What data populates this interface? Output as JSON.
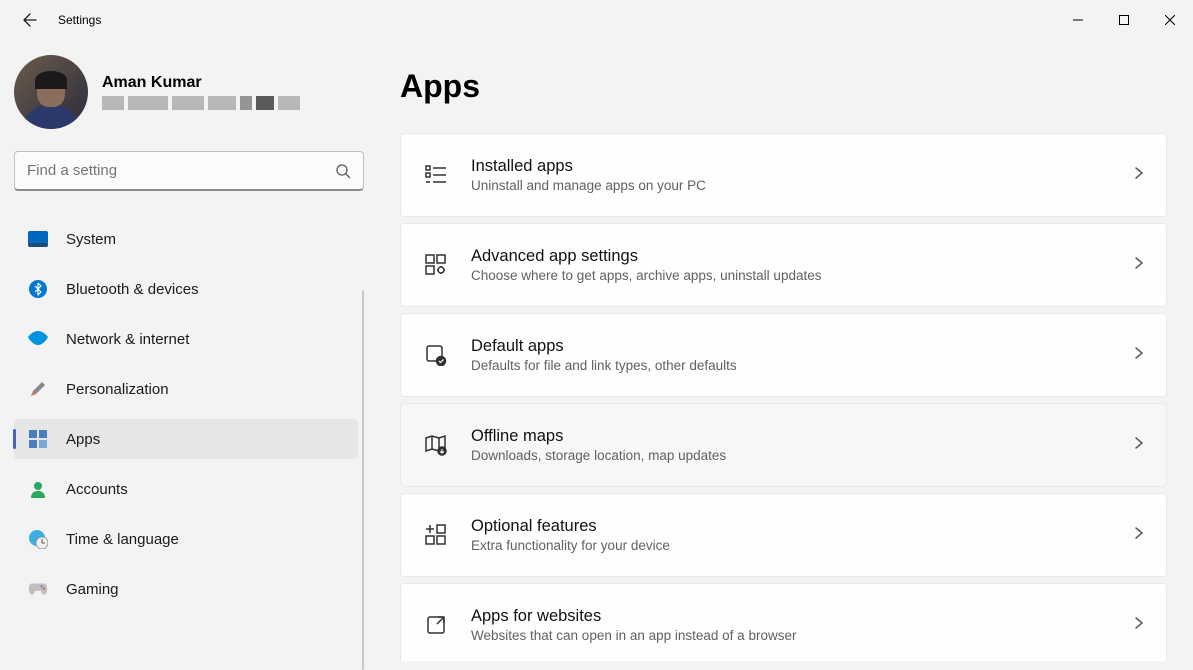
{
  "window": {
    "title": "Settings"
  },
  "profile": {
    "name": "Aman Kumar"
  },
  "search": {
    "placeholder": "Find a setting"
  },
  "sidebar": {
    "items": [
      {
        "label": "System"
      },
      {
        "label": "Bluetooth & devices"
      },
      {
        "label": "Network & internet"
      },
      {
        "label": "Personalization"
      },
      {
        "label": "Apps"
      },
      {
        "label": "Accounts"
      },
      {
        "label": "Time & language"
      },
      {
        "label": "Gaming"
      }
    ]
  },
  "page": {
    "title": "Apps"
  },
  "cards": [
    {
      "title": "Installed apps",
      "sub": "Uninstall and manage apps on your PC"
    },
    {
      "title": "Advanced app settings",
      "sub": "Choose where to get apps, archive apps, uninstall updates"
    },
    {
      "title": "Default apps",
      "sub": "Defaults for file and link types, other defaults"
    },
    {
      "title": "Offline maps",
      "sub": "Downloads, storage location, map updates"
    },
    {
      "title": "Optional features",
      "sub": "Extra functionality for your device"
    },
    {
      "title": "Apps for websites",
      "sub": "Websites that can open in an app instead of a browser"
    }
  ]
}
